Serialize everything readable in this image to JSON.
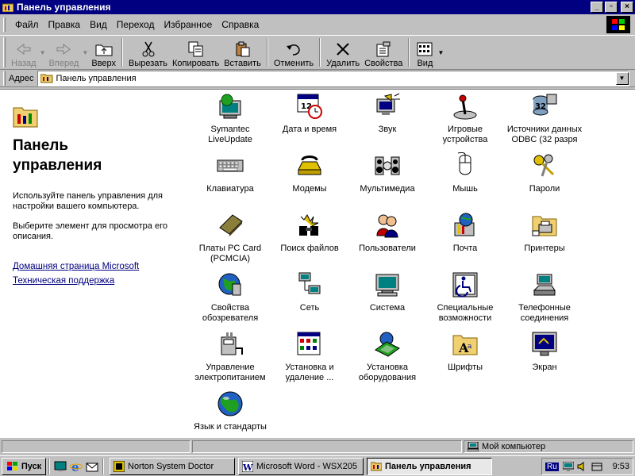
{
  "window": {
    "title": "Панель управления"
  },
  "menu": [
    "Файл",
    "Правка",
    "Вид",
    "Переход",
    "Избранное",
    "Справка"
  ],
  "toolbar": {
    "back": "Назад",
    "forward": "Вперед",
    "up": "Вверх",
    "cut": "Вырезать",
    "copy": "Копировать",
    "paste": "Вставить",
    "undo": "Отменить",
    "delete": "Удалить",
    "properties": "Свойства",
    "view": "Вид"
  },
  "address": {
    "label": "Адрес",
    "value": "Панель управления"
  },
  "left_pane": {
    "title_line1": "Панель",
    "title_line2": "управления",
    "desc1": "Используйте панель управления для настройки вашего компьютера.",
    "desc2": "Выберите элемент для просмотра его описания.",
    "link1": "Домашняя страница Microsoft",
    "link2": "Техническая поддержка"
  },
  "items": [
    {
      "label": "Symantec\nLiveUpdate",
      "icon": "liveupdate-icon"
    },
    {
      "label": "Дата и время",
      "icon": "calendar-clock-icon"
    },
    {
      "label": "Звук",
      "icon": "speaker-icon"
    },
    {
      "label": "Игровые\nустройства",
      "icon": "joystick-icon"
    },
    {
      "label": "Источники данных\nODBC (32 разря",
      "icon": "odbc-icon"
    },
    {
      "label": "Клавиатура",
      "icon": "keyboard-icon"
    },
    {
      "label": "Модемы",
      "icon": "modem-icon"
    },
    {
      "label": "Мультимедиа",
      "icon": "multimedia-icon"
    },
    {
      "label": "Мышь",
      "icon": "mouse-icon"
    },
    {
      "label": "Пароли",
      "icon": "keys-icon"
    },
    {
      "label": "Платы PC Card\n(PCMCIA)",
      "icon": "pccard-icon"
    },
    {
      "label": "Поиск файлов",
      "icon": "binoculars-icon"
    },
    {
      "label": "Пользователи",
      "icon": "users-icon"
    },
    {
      "label": "Почта",
      "icon": "mail-icon"
    },
    {
      "label": "Принтеры",
      "icon": "printers-folder-icon"
    },
    {
      "label": "Свойства\nобозревателя",
      "icon": "internet-options-icon"
    },
    {
      "label": "Сеть",
      "icon": "network-icon"
    },
    {
      "label": "Система",
      "icon": "system-icon"
    },
    {
      "label": "Специальные\nвозможности",
      "icon": "accessibility-icon"
    },
    {
      "label": "Телефонные\nсоединения",
      "icon": "telephony-icon"
    },
    {
      "label": "Управление\nэлектропитанием",
      "icon": "power-icon"
    },
    {
      "label": "Установка и\nудаление ...",
      "icon": "add-remove-icon"
    },
    {
      "label": "Установка\nоборудования",
      "icon": "add-hardware-icon"
    },
    {
      "label": "Шрифты",
      "icon": "fonts-icon"
    },
    {
      "label": "Экран",
      "icon": "display-icon"
    },
    {
      "label": "Язык и стандарты",
      "icon": "regional-globe-icon"
    }
  ],
  "status": {
    "location": "Мой компьютер"
  },
  "taskbar": {
    "start": "Пуск",
    "tasks": [
      "Norton System Doctor",
      "Microsoft Word - WSX205",
      "Панель управления"
    ],
    "lang": "Ru",
    "clock": "9:53"
  }
}
